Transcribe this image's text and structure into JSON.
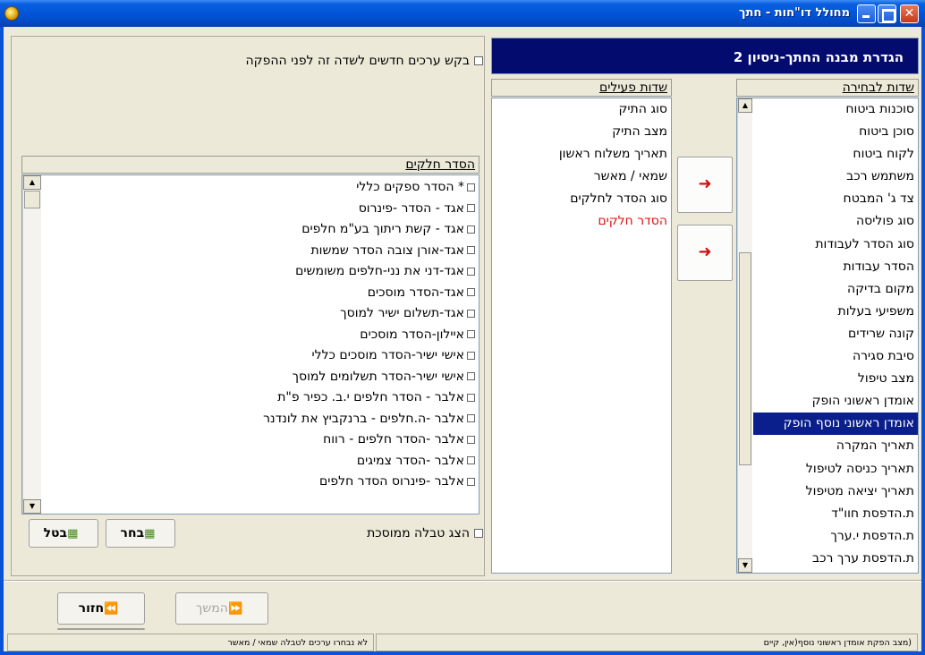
{
  "window": {
    "title": "מחולל דו\"חות - חתך"
  },
  "banner": {
    "title": "הגדרת מבנה החתך-ניסיון 2"
  },
  "request_new_values": {
    "label": "בקש ערכים חדשים לשדה זה לפני ההפקה"
  },
  "available_fields": {
    "header": "שדות לבחירה",
    "items": [
      "סוכנות ביטוח",
      "סוכן ביטוח",
      "לקוח ביטוח",
      "משתמש רכב",
      "צד ג' המבטח",
      "סוג פוליסה",
      "סוג הסדר לעבודות",
      "הסדר עבודות",
      "מקום בדיקה",
      "משפיעי בעלות",
      "קונה שרידים",
      "סיבת סגירה",
      "מצב טיפול",
      "אומדן ראשוני הופק",
      "אומדן ראשוני נוסף הופק",
      "תאריך המקרה",
      "תאריך כניסה לטיפול",
      "תאריך יציאה מטיפול",
      "ת.הדפסת חוו\"ד",
      "ת.הדפסת י.ערך",
      "ת.הדפסת ערך רכב"
    ],
    "selected": "אומדן ראשוני נוסף הופק"
  },
  "active_fields": {
    "header": "שדות פעילים",
    "items": [
      "סוג התיק",
      "מצב התיק",
      "תאריך משלוח ראשון",
      "שמאי / מאשר",
      "סוג הסדר לחלקים",
      "הסדר חלקים"
    ],
    "highlighted": "הסדר חלקים"
  },
  "parts_arrangement": {
    "header": "הסדר חלקים",
    "items": [
      "* הסדר ספקים כללי",
      "אגד - הסדר -פינרוס",
      "אגד - קשת ריתוך בע\"מ  חלפים",
      "אגד-אורן צובה הסדר שמשות",
      "אגד-דני את נני-חלפים משומשים",
      "אגד-הסדר מוסכים",
      "אגד-תשלום ישיר למוסך",
      "איילון-הסדר מוסכים",
      "אישי ישיר-הסדר מוסכים כללי",
      "אישי ישיר-הסדר תשלומים למוסך",
      "אלבר - הסדר חלפים י.ב. כפיר פ\"ת",
      "אלבר -ה.חלפים - ברנקביץ את לונדנר",
      "אלבר -הסדר חלפים - רווח",
      "אלבר -הסדר צמיגים",
      "אלבר -פינרוס הסדר חלפים"
    ]
  },
  "show_custom_table": {
    "label": "הצג טבלה ממוסכת"
  },
  "buttons": {
    "select": "בחר",
    "cancel": "בטל",
    "next": "המשך",
    "back": "חזור"
  },
  "status": {
    "left": "לא נבחרו ערכים לטבלה שמאי / מאשר",
    "right": "(מצב הפקת אומדן ראשוני נוסף(אין, קיים"
  },
  "colors": {
    "banner_bg": "#040b6e",
    "selected_bg": "#0a1f8c",
    "highlight_text": "#e01010",
    "titlebar": "#0355d8"
  }
}
